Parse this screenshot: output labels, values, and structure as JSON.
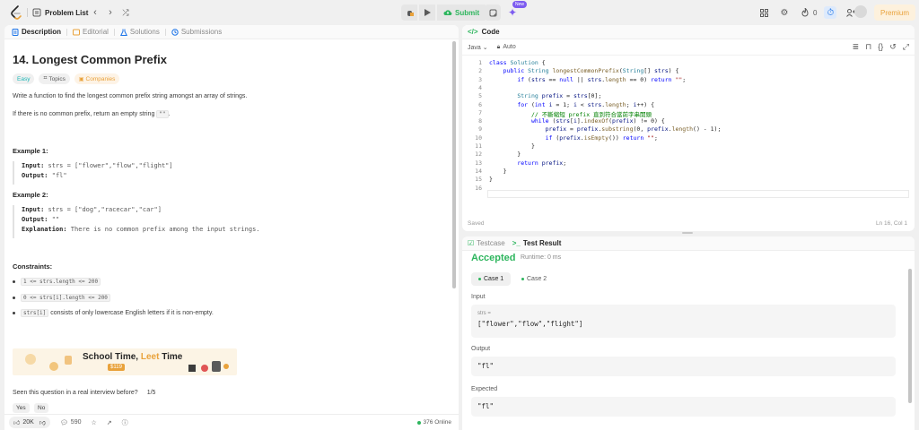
{
  "topbar": {
    "problem_list": "Problem List",
    "submit": "Submit",
    "new_badge": "New",
    "fire_count": "0",
    "premium": "Premium"
  },
  "left": {
    "tabs": [
      "Description",
      "Editorial",
      "Solutions",
      "Submissions"
    ],
    "title": "14. Longest Common Prefix",
    "tags": [
      "Easy",
      "Topics",
      "Companies"
    ],
    "desc1": "Write a function to find the longest common prefix string amongst an array of strings.",
    "desc2_pre": "If there is no common prefix, return an empty string ",
    "desc2_code": "\"\"",
    "desc2_post": ".",
    "example1_title": "Example 1:",
    "example1": {
      "input_label": "Input:",
      "input": "strs = [\"flower\",\"flow\",\"flight\"]",
      "output_label": "Output:",
      "output": "\"fl\""
    },
    "example2_title": "Example 2:",
    "example2": {
      "input_label": "Input:",
      "input": "strs = [\"dog\",\"racecar\",\"car\"]",
      "output_label": "Output:",
      "output": "\"\"",
      "expl_label": "Explanation:",
      "expl": "There is no common prefix among the input strings."
    },
    "constraints_title": "Constraints:",
    "constraints": [
      "1 <= strs.length <= 200",
      "0 <= strs[i].length <= 200"
    ],
    "constraint3_code": "strs[i]",
    "constraint3_text": "consists of only lowercase English letters if it is non-empty.",
    "banner_title_a": "School Time,",
    "banner_title_b": "Leet",
    "banner_title_c": "Time",
    "banner_price": "$119",
    "seen_question": "Seen this question in a real interview before?",
    "seen_count": "1/5",
    "yes": "Yes",
    "no": "No",
    "likes": "20K",
    "comments": "590",
    "online": "376 Online"
  },
  "code": {
    "header": "Code",
    "language": "Java",
    "auto": "Auto",
    "status": "Saved",
    "position": "Ln 16, Col 1",
    "lines": [
      "class Solution {",
      "    public String longestCommonPrefix(String[] strs) {",
      "        if (strs == null || strs.length == 0) return \"\";",
      "",
      "        String prefix = strs[0];",
      "        for (int i = 1; i < strs.length; i++) {",
      "            // 不斷縮短 prefix 直到符合當前字串開頭",
      "            while (strs[i].indexOf(prefix) != 0) {",
      "                prefix = prefix.substring(0, prefix.length() - 1);",
      "                if (prefix.isEmpty()) return \"\";",
      "            }",
      "        }",
      "        return prefix;",
      "    }",
      "}",
      ""
    ]
  },
  "test": {
    "tabs": [
      "Testcase",
      "Test Result"
    ],
    "accepted": "Accepted",
    "runtime": "Runtime: 0 ms",
    "cases": [
      "Case 1",
      "Case 2"
    ],
    "input_label": "Input",
    "input_var": "strs =",
    "input_value": "[\"flower\",\"flow\",\"flight\"]",
    "output_label": "Output",
    "output_value": "\"fl\"",
    "expected_label": "Expected",
    "expected_value": "\"fl\""
  },
  "colors": {
    "accent_green": "#2db55d",
    "premium": "#e9a23b",
    "ai_purple": "#7d5cf0"
  }
}
